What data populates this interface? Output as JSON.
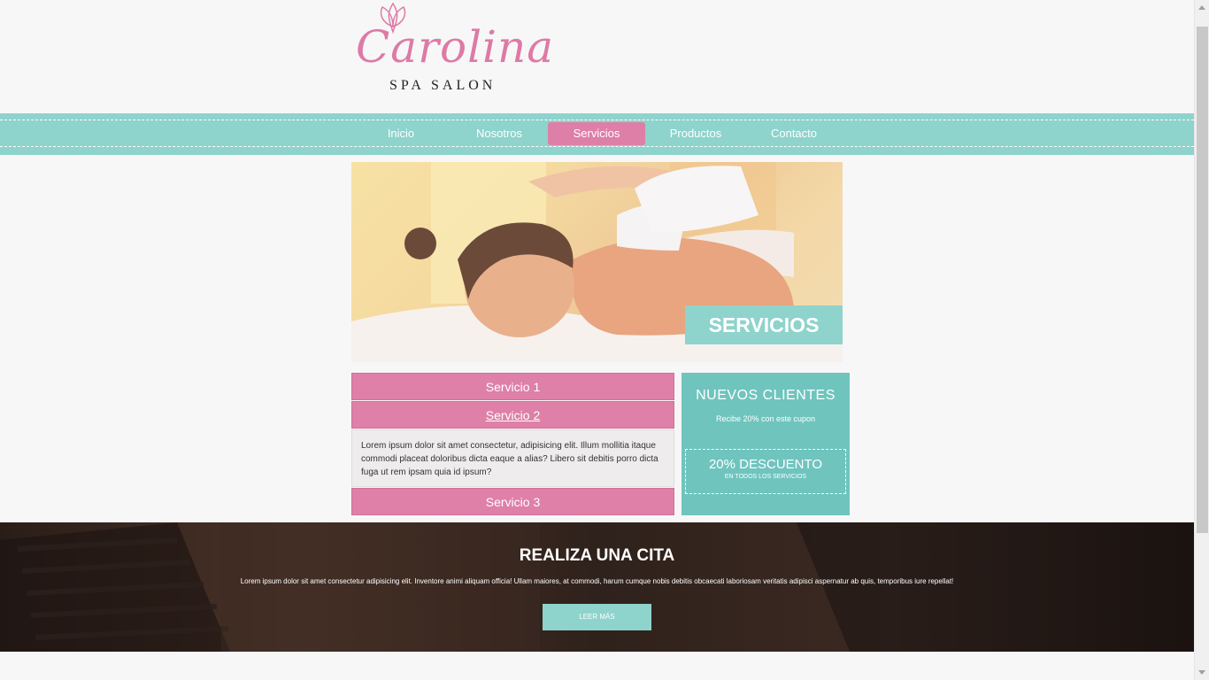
{
  "logo": {
    "name": "Carolina",
    "subtitle": "SPA SALON"
  },
  "nav": {
    "items": [
      {
        "label": "Inicio",
        "active": false
      },
      {
        "label": "Nosotros",
        "active": false
      },
      {
        "label": "Servicios",
        "active": true
      },
      {
        "label": "Productos",
        "active": false
      },
      {
        "label": "Contacto",
        "active": false
      }
    ]
  },
  "hero": {
    "label": "SERVICIOS"
  },
  "services": {
    "items": [
      {
        "title": "Servicio 1",
        "open": false
      },
      {
        "title": "Servicio 2",
        "open": true,
        "body": "Lorem ipsum dolor sit amet consectetur, adipisicing elit. Illum mollitia itaque commodi placeat doloribus dicta eaque a alias? Libero sit debitis porro dicta fuga ut rem ipsam quia id ipsum?"
      },
      {
        "title": "Servicio 3",
        "open": false
      }
    ]
  },
  "promo": {
    "title": "NUEVOS CLIENTES",
    "text": "Recibe 20% con este cupon",
    "coupon_big": "20% DESCUENTO",
    "coupon_small": "EN TODOS LOS SERVICIOS"
  },
  "appointment": {
    "title": "REALIZA UNA CITA",
    "text": "Lorem ipsum dolor sit amet consectetur adipisicing elit. Inventore animi aliquam officia! Ullam maiores, at commodi, harum cumque nobis debitis obcaecati laboriosam veritatis adipisci aspernatur ab quis, temporibus iure repellat!",
    "button": "LEER MÁS"
  },
  "colors": {
    "pink": "#de80a8",
    "teal": "#8ed3cc",
    "teal_dark": "#6fc4be"
  }
}
